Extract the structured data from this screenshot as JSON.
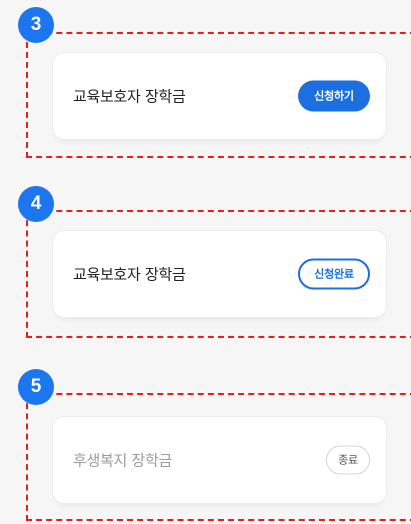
{
  "steps": [
    {
      "number": "3",
      "title": "교육보호자 장학금",
      "button_label": "신청하기",
      "state": "apply"
    },
    {
      "number": "4",
      "title": "교육보호자 장학금",
      "button_label": "신청완료",
      "state": "applied"
    },
    {
      "number": "5",
      "title": "후생복지 장학금",
      "button_label": "종료",
      "state": "ended"
    }
  ],
  "colors": {
    "accent": "#1b6fe0",
    "badge": "#1b76f0",
    "dashed_outline": "#e0211d",
    "background": "#f6f6f7"
  }
}
